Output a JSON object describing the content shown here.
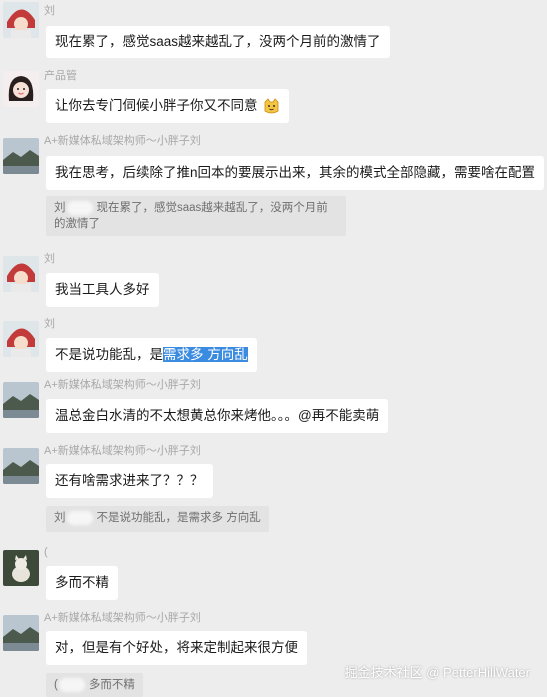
{
  "messages": [
    {
      "sender": "刘",
      "text": "现在累了，感觉saas越来越乱了，没两个月前的激情了"
    },
    {
      "sender": "产品管",
      "text": "让你去专门伺候小胖子你又不同意"
    },
    {
      "sender": "A+新媒体私域架构师～小胖子刘",
      "text": "我在思考，后续除了推n回本的要展示出来，其余的模式全部隐藏，需要啥在配置",
      "quote": {
        "name": "刘",
        "line1": "现在累了，感觉saas越来越乱了，没两个月前",
        "line2": "的激情了"
      }
    },
    {
      "sender": "刘",
      "text": "我当工具人多好"
    },
    {
      "sender": "刘",
      "text_before": "不是说功能乱，是",
      "text_highlight": "需求多 方向乱"
    },
    {
      "sender": "A+新媒体私域架构师～小胖子刘",
      "text": "温总金白水清的不太想黄总你来烤他。。。@再不能卖萌"
    },
    {
      "sender": "A+新媒体私域架构师～小胖子刘",
      "text": "还有啥需求进来了？？？",
      "quote": {
        "name": "刘",
        "line1": "不是说功能乱，是需求多 方向乱"
      }
    },
    {
      "sender": "(",
      "text": "多而不精"
    },
    {
      "sender": "A+新媒体私域架构师～小胖子刘",
      "text": "对，但是有个好处，将来定制起来很方便",
      "quote": {
        "name": "(",
        "line1": "多而不精"
      }
    }
  ],
  "emoji": "cat-face-emoji",
  "watermark": "掘金技术社区 @ PetterHillWater",
  "colors": {
    "background": "#ededed",
    "bubble": "#ffffff",
    "quote": "#e3e3e3",
    "sender": "#a8a8a8",
    "highlight": "#3b8be0"
  }
}
